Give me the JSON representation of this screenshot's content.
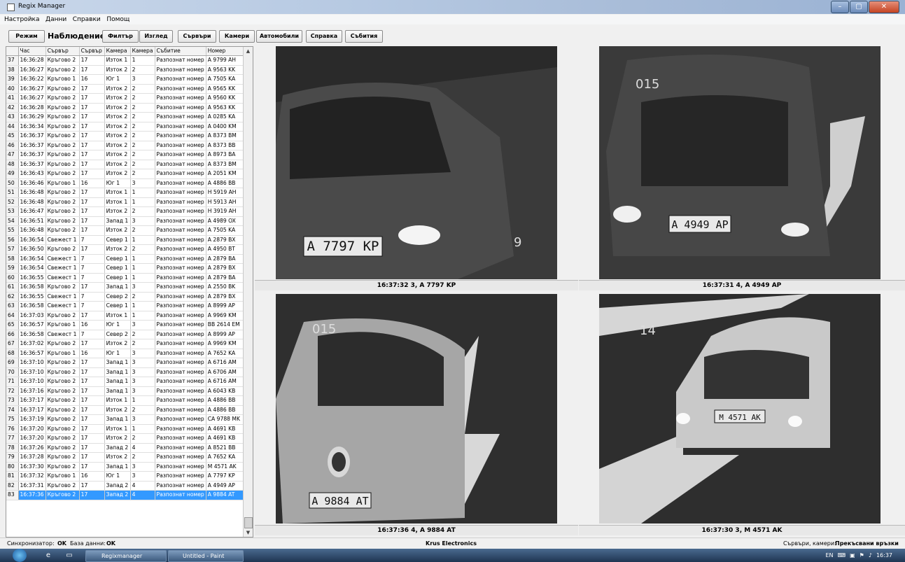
{
  "window": {
    "title": "Regix Manager",
    "controls": {
      "minimize": "–",
      "maximize": "▢",
      "close": "✕"
    }
  },
  "menu": [
    "Настройка",
    "Данни",
    "Справки",
    "Помощ"
  ],
  "toolbar": {
    "buttons": [
      "Режим",
      "Филтър",
      "Изглед",
      "Сървъри",
      "Камери",
      "Автомобили",
      "Справка",
      "Събития"
    ],
    "active_label": "Наблюдение"
  },
  "grid": {
    "columns": [
      "Час",
      "Сървър",
      "Сървър",
      "Камера",
      "Камера",
      "Събитие",
      "Номер"
    ],
    "rows": [
      [
        37,
        "16:36:28",
        "Кръгово 2",
        "17",
        "Изток 1",
        "1",
        "Разпознат номер",
        "A 9799 AH"
      ],
      [
        38,
        "16:36:27",
        "Кръгово 2",
        "17",
        "Изток 2",
        "2",
        "Разпознат номер",
        "A 9563 KK"
      ],
      [
        39,
        "16:36:22",
        "Кръгово 1",
        "16",
        "Юг 1",
        "3",
        "Разпознат номер",
        "A 7505 KA"
      ],
      [
        40,
        "16:36:27",
        "Кръгово 2",
        "17",
        "Изток 2",
        "2",
        "Разпознат номер",
        "A 9565 KK"
      ],
      [
        41,
        "16:36:27",
        "Кръгово 2",
        "17",
        "Изток 2",
        "2",
        "Разпознат номер",
        "A 9560 KK"
      ],
      [
        42,
        "16:36:28",
        "Кръгово 2",
        "17",
        "Изток 2",
        "2",
        "Разпознат номер",
        "A 9563 KK"
      ],
      [
        43,
        "16:36:29",
        "Кръгово 2",
        "17",
        "Изток 2",
        "2",
        "Разпознат номер",
        "A 0285 KA"
      ],
      [
        44,
        "16:36:34",
        "Кръгово 2",
        "17",
        "Изток 2",
        "2",
        "Разпознат номер",
        "A 0400 KM"
      ],
      [
        45,
        "16:36:37",
        "Кръгово 2",
        "17",
        "Изток 2",
        "2",
        "Разпознат номер",
        "A 8373 BM"
      ],
      [
        46,
        "16:36:37",
        "Кръгово 2",
        "17",
        "Изток 2",
        "2",
        "Разпознат номер",
        "A 8373 BB"
      ],
      [
        47,
        "16:36:37",
        "Кръгово 2",
        "17",
        "Изток 2",
        "2",
        "Разпознат номер",
        "A 8973 BA"
      ],
      [
        48,
        "16:36:37",
        "Кръгово 2",
        "17",
        "Изток 2",
        "2",
        "Разпознат номер",
        "A 8373 BM"
      ],
      [
        49,
        "16:36:43",
        "Кръгово 2",
        "17",
        "Изток 2",
        "2",
        "Разпознат номер",
        "A 2051 KM"
      ],
      [
        50,
        "16:36:46",
        "Кръгово 1",
        "16",
        "Юг 1",
        "3",
        "Разпознат номер",
        "A 4886 BB"
      ],
      [
        51,
        "16:36:48",
        "Кръгово 2",
        "17",
        "Изток 1",
        "1",
        "Разпознат номер",
        "H 5919 AH"
      ],
      [
        52,
        "16:36:48",
        "Кръгово 2",
        "17",
        "Изток 1",
        "1",
        "Разпознат номер",
        "H 5913 AH"
      ],
      [
        53,
        "16:36:47",
        "Кръгово 2",
        "17",
        "Изток 2",
        "2",
        "Разпознат номер",
        "H 3919 AH"
      ],
      [
        54,
        "16:36:51",
        "Кръгово 2",
        "17",
        "Запад 1",
        "3",
        "Разпознат номер",
        "A 4989 OX"
      ],
      [
        55,
        "16:36:48",
        "Кръгово 2",
        "17",
        "Изток 2",
        "2",
        "Разпознат номер",
        "A 7505 KA"
      ],
      [
        56,
        "16:36:54",
        "Свежест 1",
        "7",
        "Север 1",
        "1",
        "Разпознат номер",
        "A 2879 BX"
      ],
      [
        57,
        "16:36:50",
        "Кръгово 2",
        "17",
        "Изток 2",
        "2",
        "Разпознат номер",
        "A 4950 BT"
      ],
      [
        58,
        "16:36:54",
        "Свежест 1",
        "7",
        "Север 1",
        "1",
        "Разпознат номер",
        "A 2879 BA"
      ],
      [
        59,
        "16:36:54",
        "Свежест 1",
        "7",
        "Север 1",
        "1",
        "Разпознат номер",
        "A 2879 BX"
      ],
      [
        60,
        "16:36:55",
        "Свежест 1",
        "7",
        "Север 1",
        "1",
        "Разпознат номер",
        "A 2879 BA"
      ],
      [
        61,
        "16:36:58",
        "Кръгово 2",
        "17",
        "Запад 1",
        "3",
        "Разпознат номер",
        "A 2550 BK"
      ],
      [
        62,
        "16:36:55",
        "Свежест 1",
        "7",
        "Север 2",
        "2",
        "Разпознат номер",
        "A 2879 BX"
      ],
      [
        63,
        "16:36:58",
        "Свежест 1",
        "7",
        "Север 1",
        "1",
        "Разпознат номер",
        "A 8999 AP"
      ],
      [
        64,
        "16:37:03",
        "Кръгово 2",
        "17",
        "Изток 1",
        "1",
        "Разпознат номер",
        "A 9969 KM"
      ],
      [
        65,
        "16:36:57",
        "Кръгово 1",
        "16",
        "Юг 1",
        "3",
        "Разпознат номер",
        "BB 2614 EM"
      ],
      [
        66,
        "16:36:58",
        "Свежест 1",
        "7",
        "Север 2",
        "2",
        "Разпознат номер",
        "A 8999 AP"
      ],
      [
        67,
        "16:37:02",
        "Кръгово 2",
        "17",
        "Изток 2",
        "2",
        "Разпознат номер",
        "A 9969 KM"
      ],
      [
        68,
        "16:36:57",
        "Кръгово 1",
        "16",
        "Юг 1",
        "3",
        "Разпознат номер",
        "A 7652 KA"
      ],
      [
        69,
        "16:37:10",
        "Кръгово 2",
        "17",
        "Запад 1",
        "3",
        "Разпознат номер",
        "A 6716 AM"
      ],
      [
        70,
        "16:37:10",
        "Кръгово 2",
        "17",
        "Запад 1",
        "3",
        "Разпознат номер",
        "A 6706 AM"
      ],
      [
        71,
        "16:37:10",
        "Кръгово 2",
        "17",
        "Запад 1",
        "3",
        "Разпознат номер",
        "A 6716 AM"
      ],
      [
        72,
        "16:37:16",
        "Кръгово 2",
        "17",
        "Запад 1",
        "3",
        "Разпознат номер",
        "A 6043 KB"
      ],
      [
        73,
        "16:37:17",
        "Кръгово 2",
        "17",
        "Изток 1",
        "1",
        "Разпознат номер",
        "A 4886 BB"
      ],
      [
        74,
        "16:37:17",
        "Кръгово 2",
        "17",
        "Изток 2",
        "2",
        "Разпознат номер",
        "A 4886 BB"
      ],
      [
        75,
        "16:37:19",
        "Кръгово 2",
        "17",
        "Запад 1",
        "3",
        "Разпознат номер",
        "CA 9788 MK"
      ],
      [
        76,
        "16:37:20",
        "Кръгово 2",
        "17",
        "Изток 1",
        "1",
        "Разпознат номер",
        "A 4691 KB"
      ],
      [
        77,
        "16:37:20",
        "Кръгово 2",
        "17",
        "Изток 2",
        "2",
        "Разпознат номер",
        "A 4691 KB"
      ],
      [
        78,
        "16:37:26",
        "Кръгово 2",
        "17",
        "Запад 2",
        "4",
        "Разпознат номер",
        "A 8521 BB"
      ],
      [
        79,
        "16:37:28",
        "Кръгово 2",
        "17",
        "Изток 2",
        "2",
        "Разпознат номер",
        "A 7652 KA"
      ],
      [
        80,
        "16:37:30",
        "Кръгово 2",
        "17",
        "Запад 1",
        "3",
        "Разпознат номер",
        "M 4571 AK"
      ],
      [
        81,
        "16:37:32",
        "Кръгово 1",
        "16",
        "Юг 1",
        "3",
        "Разпознат номер",
        "A 7797 KP"
      ],
      [
        82,
        "16:37:31",
        "Кръгово 2",
        "17",
        "Запад 2",
        "4",
        "Разпознат номер",
        "A 4949 AP"
      ],
      [
        83,
        "16:37:36",
        "Кръгово 2",
        "17",
        "Запад 2",
        "4",
        "Разпознат номер",
        "A 9884 AT"
      ]
    ],
    "selected_row": 83
  },
  "cameras": [
    {
      "caption": "16:37:32  3, A 7797 KP",
      "plate": "A 7797 KP",
      "overlay": "9"
    },
    {
      "caption": "16:37:31  4, A 4949 AP",
      "plate": "A 4949 AP",
      "overlay": "015"
    },
    {
      "caption": "16:37:36  4, A 9884 AT",
      "plate": "A 9884 AT",
      "overlay": "015"
    },
    {
      "caption": "16:37:30  3, M 4571 AK",
      "plate": "M 4571 AK",
      "overlay": "14"
    }
  ],
  "status": {
    "sync_label": "Синхронизатор:",
    "sync_value": "OK",
    "db_label": "База данни:",
    "db_value": "OK",
    "center": "Krus Electronics",
    "right_label": "Сървъри, камери:",
    "right_action": "Прекъсвани връзки"
  },
  "taskbar": {
    "tasks": [
      "Regixmanager",
      "Untitled - Paint"
    ],
    "lang": "EN",
    "clock": "16:37"
  }
}
